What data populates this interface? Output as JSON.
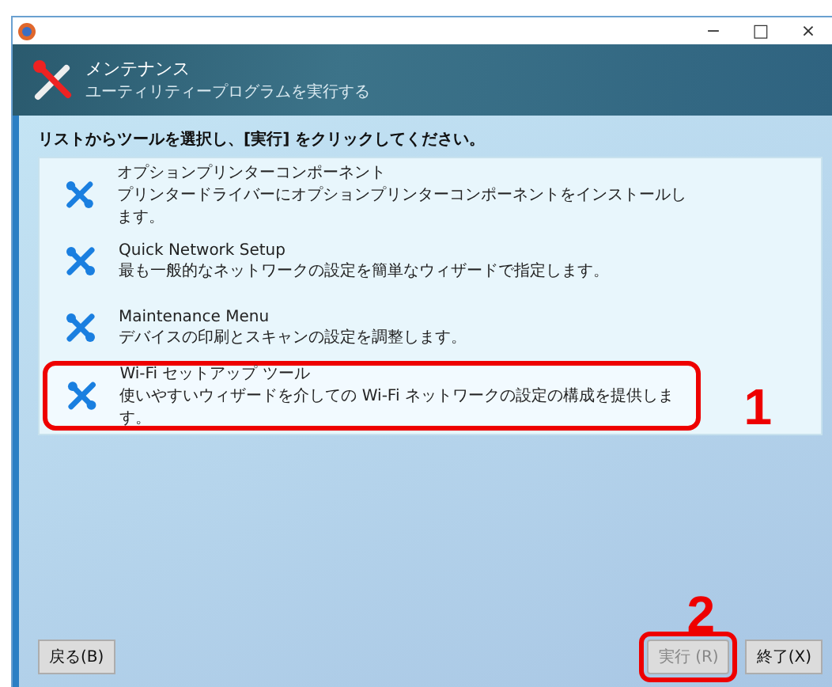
{
  "window": {
    "controls": [
      "−",
      "□",
      "×"
    ]
  },
  "header": {
    "title": "メンテナンス",
    "subtitle": "ユーティリティープログラムを実行する"
  },
  "instruction": "リストからツールを選択し、[実行] をクリックしてください。",
  "tools": [
    {
      "name": "オプションプリンターコンポーネント",
      "description": "プリンタードライバーにオプションプリンターコンポーネントをインストールします。",
      "selected": false
    },
    {
      "name": "Quick Network Setup",
      "description": "最も一般的なネットワークの設定を簡単なウィザードで指定します。",
      "selected": false
    },
    {
      "name": "Maintenance Menu",
      "description": "デバイスの印刷とスキャンの設定を調整します。",
      "selected": false
    },
    {
      "name": "Wi-Fi セットアップ ツール",
      "description": "使いやすいウィザードを介しての Wi-Fi ネットワークの設定の構成を提供します。",
      "selected": true
    }
  ],
  "annotations": [
    "1",
    "2"
  ],
  "buttons": [
    {
      "label": "戻る(B)",
      "disabled": false
    },
    {
      "label": "実行 (R)",
      "disabled": true,
      "highlighted": true
    },
    {
      "label": "終了(X)",
      "disabled": false
    }
  ]
}
